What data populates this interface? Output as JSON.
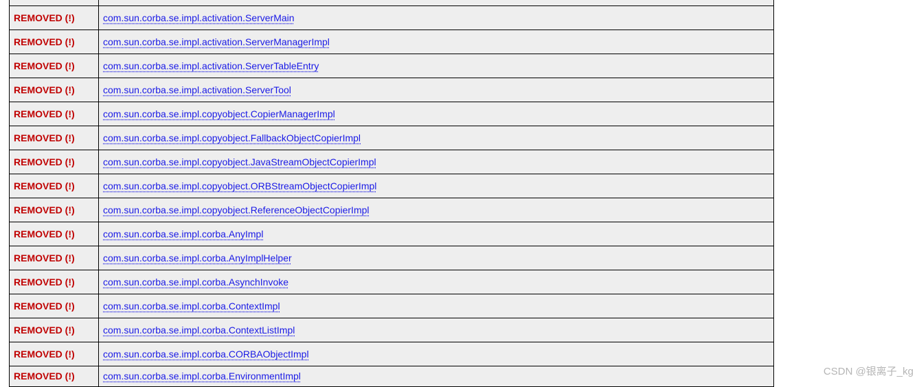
{
  "status_label": "REMOVED (!)",
  "rows": {
    "0": {
      "class": ""
    },
    "1": {
      "class": "com.sun.corba.se.impl.activation.ServerMain"
    },
    "2": {
      "class": "com.sun.corba.se.impl.activation.ServerManagerImpl"
    },
    "3": {
      "class": "com.sun.corba.se.impl.activation.ServerTableEntry"
    },
    "4": {
      "class": "com.sun.corba.se.impl.activation.ServerTool"
    },
    "5": {
      "class": "com.sun.corba.se.impl.copyobject.CopierManagerImpl"
    },
    "6": {
      "class": "com.sun.corba.se.impl.copyobject.FallbackObjectCopierImpl"
    },
    "7": {
      "class": "com.sun.corba.se.impl.copyobject.JavaStreamObjectCopierImpl"
    },
    "8": {
      "class": "com.sun.corba.se.impl.copyobject.ORBStreamObjectCopierImpl"
    },
    "9": {
      "class": "com.sun.corba.se.impl.copyobject.ReferenceObjectCopierImpl"
    },
    "10": {
      "class": "com.sun.corba.se.impl.corba.AnyImpl"
    },
    "11": {
      "class": "com.sun.corba.se.impl.corba.AnyImplHelper"
    },
    "12": {
      "class": "com.sun.corba.se.impl.corba.AsynchInvoke"
    },
    "13": {
      "class": "com.sun.corba.se.impl.corba.ContextImpl"
    },
    "14": {
      "class": "com.sun.corba.se.impl.corba.ContextListImpl"
    },
    "15": {
      "class": "com.sun.corba.se.impl.corba.CORBAObjectImpl"
    },
    "16": {
      "class": "com.sun.corba.se.impl.corba.EnvironmentImpl"
    }
  },
  "watermark": "CSDN @银离子_kg"
}
